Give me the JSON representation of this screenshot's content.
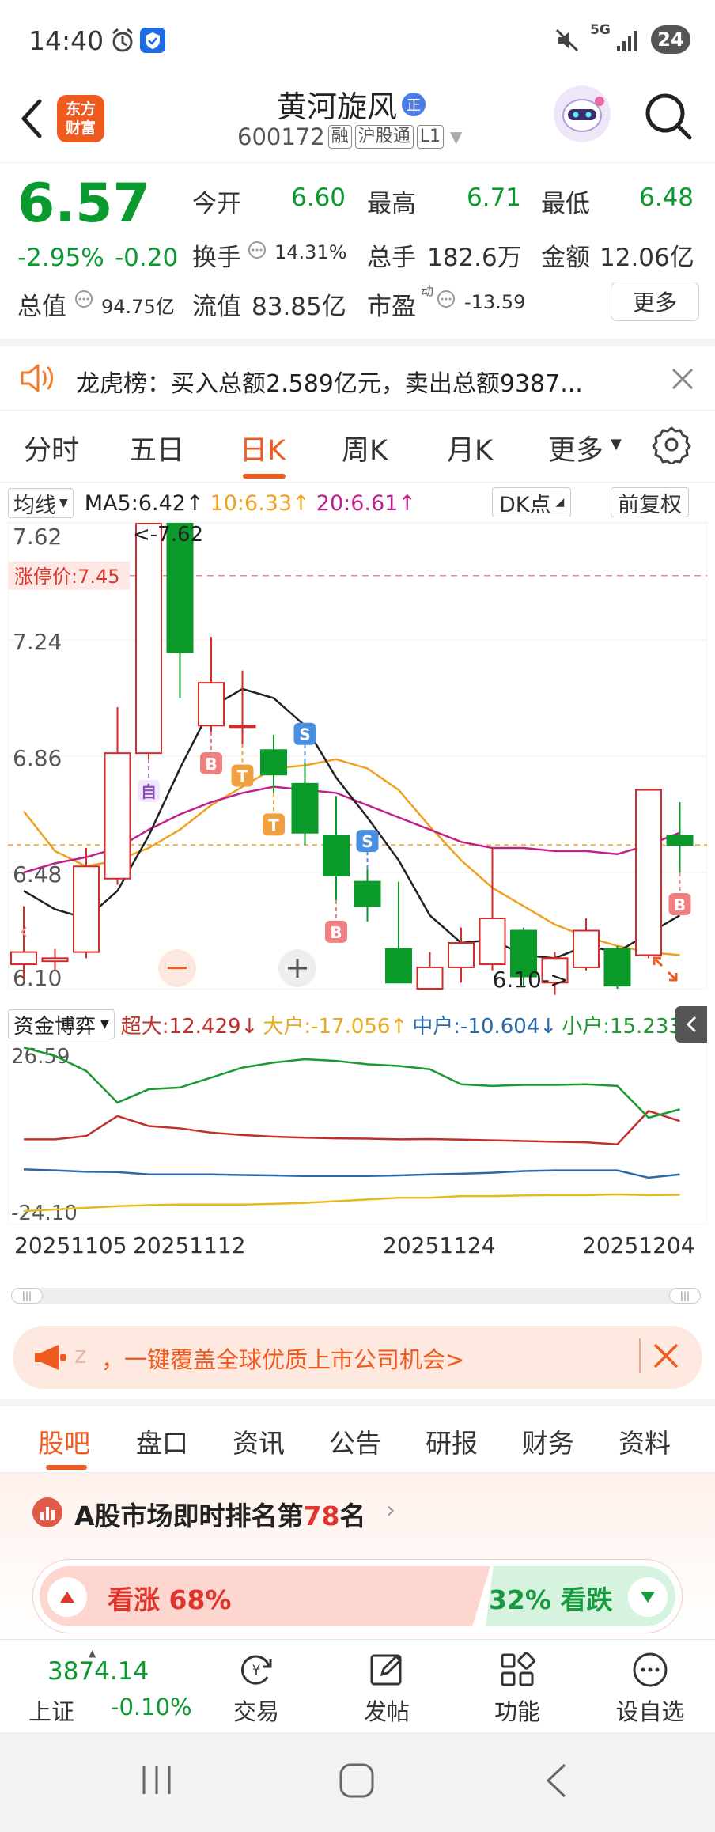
{
  "status_bar": {
    "time": "14:40",
    "network": "5G",
    "battery": "24"
  },
  "header": {
    "title": "黄河旋风",
    "title_badge": "正",
    "code": "600172",
    "tags": [
      "融",
      "沪股通",
      "L1"
    ]
  },
  "quote": {
    "price": "6.57",
    "change_pct": "-2.95%",
    "change_amt": "-0.20",
    "open_label": "今开",
    "open_val": "6.60",
    "high_label": "最高",
    "high_val": "6.71",
    "low_label": "最低",
    "low_val": "6.48",
    "turnover_label": "换手",
    "turnover_val": "14.31%",
    "volume_label": "总手",
    "volume_val": "182.6万",
    "amount_label": "金额",
    "amount_val": "12.06亿",
    "mcap_label": "总值",
    "mcap_val": "94.75亿",
    "float_label": "流值",
    "float_val": "83.85亿",
    "pe_label": "市盈",
    "pe_sup": "动",
    "pe_val": "-13.59",
    "more_button": "更多"
  },
  "notice": {
    "text": "龙虎榜：买入总额2.589亿元，卖出总额9387..."
  },
  "ktabs": [
    {
      "label": "分时"
    },
    {
      "label": "五日"
    },
    {
      "label": "日K"
    },
    {
      "label": "周K"
    },
    {
      "label": "月K"
    },
    {
      "label": "更多"
    }
  ],
  "indicator_bar": {
    "ma_select": "均线",
    "ma5": "MA5:6.42",
    "ma10": "10:6.33",
    "ma20": "20:6.61",
    "dk_button": "DK点",
    "adjust_button": "前复权",
    "colors": {
      "ma5": "#222222",
      "ma10": "#f0a020",
      "ma20": "#c0208a"
    }
  },
  "chart_data": {
    "type": "candlestick",
    "ylim": [
      6.1,
      7.62
    ],
    "y_ticks": [
      "7.62",
      "7.24",
      "6.86",
      "6.48",
      "6.10"
    ],
    "limit_up_label": "涨停价:7.45",
    "limit_up_value": 7.45,
    "current_price_line": 6.57,
    "max_annotation": "<-7.62",
    "min_annotation": "6.10->",
    "candles": [
      {
        "o": 6.18,
        "c": 6.22,
        "h": 6.37,
        "l": 6.13
      },
      {
        "o": 6.19,
        "c": 6.2,
        "h": 6.23,
        "l": 6.16
      },
      {
        "o": 6.22,
        "c": 6.5,
        "h": 6.56,
        "l": 6.2
      },
      {
        "o": 6.46,
        "c": 6.87,
        "h": 7.02,
        "l": 6.44
      },
      {
        "o": 6.87,
        "c": 7.62,
        "h": 7.62,
        "l": 6.85
      },
      {
        "o": 7.62,
        "c": 7.2,
        "h": 7.62,
        "l": 7.05
      },
      {
        "o": 6.96,
        "c": 7.1,
        "h": 7.25,
        "l": 6.94
      },
      {
        "o": 6.96,
        "c": 6.96,
        "h": 7.14,
        "l": 6.9
      },
      {
        "o": 6.88,
        "c": 6.8,
        "h": 6.93,
        "l": 6.74
      },
      {
        "o": 6.77,
        "c": 6.61,
        "h": 6.84,
        "l": 6.57
      },
      {
        "o": 6.6,
        "c": 6.47,
        "h": 6.73,
        "l": 6.39
      },
      {
        "o": 6.45,
        "c": 6.37,
        "h": 6.49,
        "l": 6.32
      },
      {
        "o": 6.23,
        "c": 6.12,
        "h": 6.45,
        "l": 6.12
      },
      {
        "o": 6.1,
        "c": 6.17,
        "h": 6.22,
        "l": 6.1
      },
      {
        "o": 6.17,
        "c": 6.25,
        "h": 6.3,
        "l": 6.12
      },
      {
        "o": 6.18,
        "c": 6.33,
        "h": 6.56,
        "l": 6.16
      },
      {
        "o": 6.29,
        "c": 6.14,
        "h": 6.3,
        "l": 6.11
      },
      {
        "o": 6.12,
        "c": 6.2,
        "h": 6.22,
        "l": 6.08
      },
      {
        "o": 6.17,
        "c": 6.29,
        "h": 6.33,
        "l": 6.16
      },
      {
        "o": 6.23,
        "c": 6.11,
        "h": 6.24,
        "l": 6.1
      },
      {
        "o": 6.21,
        "c": 6.75,
        "h": 6.75,
        "l": 6.2
      },
      {
        "o": 6.6,
        "c": 6.57,
        "h": 6.71,
        "l": 6.48
      }
    ],
    "ma5": [
      6.42,
      6.36,
      6.33,
      6.42,
      6.6,
      6.82,
      7.02,
      7.08,
      7.05,
      6.96,
      6.79,
      6.66,
      6.52,
      6.34,
      6.25,
      6.26,
      6.21,
      6.2,
      6.24,
      6.22,
      6.28,
      6.34
    ],
    "ma10": [
      6.68,
      6.55,
      6.5,
      6.52,
      6.56,
      6.62,
      6.7,
      6.76,
      6.82,
      6.83,
      6.85,
      6.82,
      6.75,
      6.63,
      6.52,
      6.43,
      6.37,
      6.31,
      6.27,
      6.24,
      6.22,
      6.21
    ],
    "ma20": [
      6.48,
      6.51,
      6.53,
      6.56,
      6.62,
      6.67,
      6.71,
      6.74,
      6.76,
      6.75,
      6.74,
      6.7,
      6.66,
      6.62,
      6.58,
      6.56,
      6.56,
      6.55,
      6.55,
      6.54,
      6.57,
      6.61
    ],
    "markers": [
      {
        "idx": 4,
        "label": "自"
      },
      {
        "idx": 6,
        "label": "B"
      },
      {
        "idx": 7,
        "label": "T"
      },
      {
        "idx": 8,
        "label": "T"
      },
      {
        "idx": 9,
        "label": "S"
      },
      {
        "idx": 10,
        "label": "B"
      },
      {
        "idx": 11,
        "label": "S"
      },
      {
        "idx": 21,
        "label": "B"
      }
    ],
    "x_ticks": [
      "20251105",
      "20251112",
      "20251124",
      "20251204"
    ]
  },
  "fund_flow": {
    "select": "资金博弈",
    "super_label": "超大:12.429",
    "big_label": "大户:-17.056",
    "mid_label": "中户:-10.604",
    "small_label": "小户:15.233",
    "y_top": "26.59",
    "y_bottom": "-24.10",
    "colors": {
      "super": "#c0302a",
      "big": "#e8b820",
      "mid": "#2a6aaa",
      "small": "#1a9a30"
    },
    "chart_data": {
      "type": "line",
      "ylim": [
        -24.1,
        26.59
      ],
      "series": [
        {
          "name": "超大",
          "values": [
            -0.5,
            -0.5,
            0.5,
            6.5,
            3.5,
            2.8,
            1.5,
            0.8,
            0.3,
            0.0,
            -0.2,
            -0.3,
            -0.5,
            -0.4,
            -0.6,
            -0.8,
            -1.0,
            -1.2,
            -1.4,
            -2.0,
            8.0,
            5.0
          ]
        },
        {
          "name": "大户",
          "values": [
            -22.0,
            -21.5,
            -21.0,
            -20.5,
            -20.2,
            -20.0,
            -20.0,
            -20.0,
            -19.8,
            -19.5,
            -19.0,
            -18.5,
            -18.0,
            -18.0,
            -17.5,
            -17.5,
            -17.3,
            -17.2,
            -17.2,
            -17.0,
            -17.2,
            -17.1
          ]
        },
        {
          "name": "中户",
          "values": [
            -9.5,
            -9.8,
            -10.2,
            -10.3,
            -11.0,
            -11.0,
            -11.0,
            -11.2,
            -11.3,
            -11.5,
            -11.5,
            -11.5,
            -11.3,
            -11.0,
            -10.8,
            -10.5,
            -10.0,
            -9.8,
            -9.8,
            -9.8,
            -12.0,
            -11.0
          ]
        },
        {
          "name": "小户",
          "values": [
            27.0,
            24.5,
            20.0,
            10.5,
            14.5,
            15.0,
            18.0,
            21.0,
            22.5,
            23.5,
            23.0,
            22.0,
            21.5,
            20.5,
            16.0,
            15.5,
            15.8,
            15.8,
            16.0,
            15.5,
            6.0,
            8.5
          ]
        }
      ]
    }
  },
  "banner": {
    "text": "，一键覆盖全球优质上市公司机会>",
    "prefix": "z"
  },
  "subtabs": [
    {
      "label": "股吧"
    },
    {
      "label": "盘口"
    },
    {
      "label": "资讯"
    },
    {
      "label": "公告"
    },
    {
      "label": "研报"
    },
    {
      "label": "财务"
    },
    {
      "label": "资料"
    }
  ],
  "ranking": {
    "prefix": "A股市场即时排名第",
    "rank": "78",
    "suffix": "名"
  },
  "sentiment": {
    "up_label": "看涨 68%",
    "down_label": "32% 看跌"
  },
  "bottom_nav": {
    "index_value": "3874.14",
    "index_name": "上证",
    "index_change": "-0.10%",
    "items": [
      {
        "label": "交易"
      },
      {
        "label": "发帖"
      },
      {
        "label": "功能"
      },
      {
        "label": "设自选"
      }
    ]
  }
}
